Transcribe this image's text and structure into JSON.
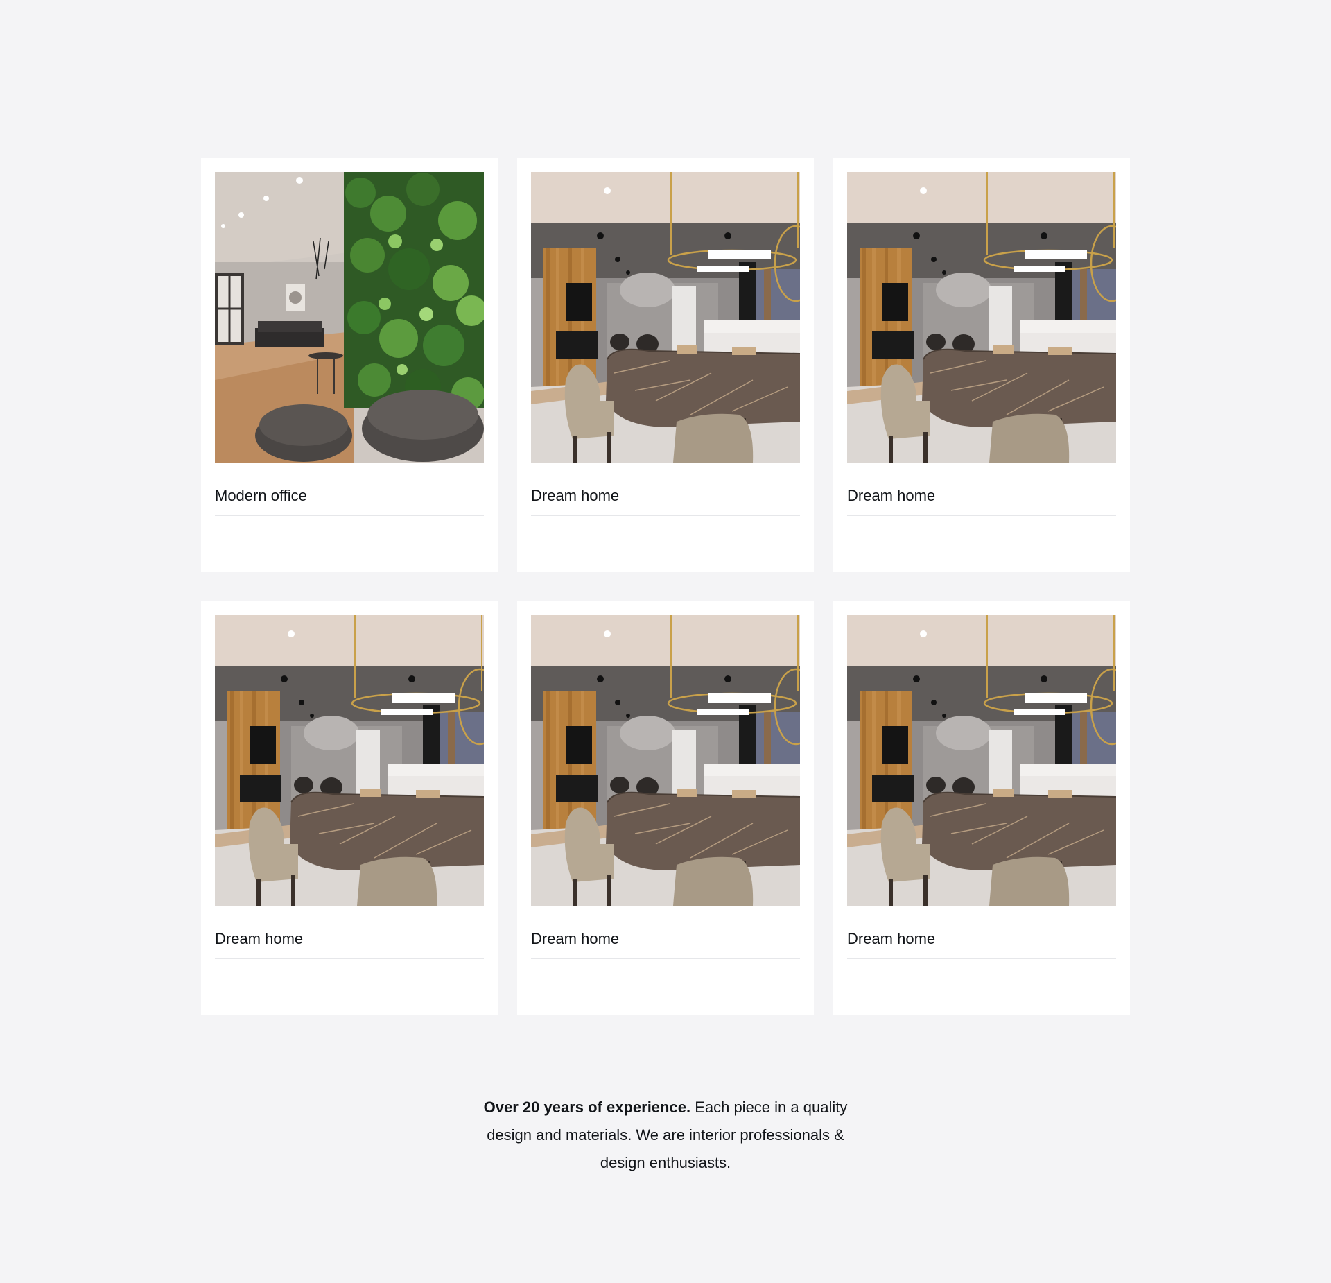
{
  "projects": [
    {
      "title": "Modern office",
      "image": "office-green-wall-lounge"
    },
    {
      "title": "Dream home",
      "image": "dining-room-marble-table"
    },
    {
      "title": "Dream home",
      "image": "dining-room-marble-table"
    },
    {
      "title": "Dream home",
      "image": "dining-room-marble-table"
    },
    {
      "title": "Dream home",
      "image": "dining-room-marble-table"
    },
    {
      "title": "Dream home",
      "image": "dining-room-marble-table"
    }
  ],
  "about": {
    "highlight": "Over 20 years of experience.",
    "text": " Each piece in a quality design and materials. We are interior professionals & design enthusiasts."
  },
  "colors": {
    "page_background": "#f4f4f6",
    "card_background": "#ffffff",
    "divider": "#e6e7ea",
    "text": "#111418"
  }
}
